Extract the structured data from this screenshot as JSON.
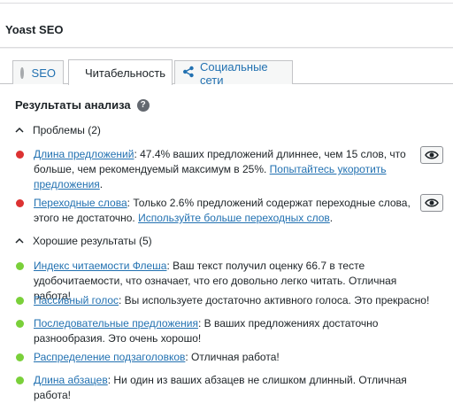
{
  "header": {
    "title": "Yoast SEO"
  },
  "tabs": [
    {
      "label": "SEO",
      "status_color": "#a7aaad"
    },
    {
      "label": "Читабельность",
      "status_color": "#ee7c1b"
    },
    {
      "label": "Социальные сети"
    }
  ],
  "panel": {
    "title": "Результаты анализа",
    "help_icon": "?",
    "problems": {
      "heading": "Проблемы (2)",
      "items": [
        {
          "link": "Длина предложений",
          "text": ": 47.4% ваших предложений длиннее, чем 15 слов, что больше, чем рекомендуемый максимум в 25%. ",
          "link2": "Попытайтесь укоротить предложения",
          "end": "."
        },
        {
          "link": "Переходные слова",
          "text": ": Только 2.6% предложений содержат переходные слова, этого не достаточно. ",
          "link2": "Используйте больше переходных слов",
          "end": "."
        }
      ]
    },
    "good": {
      "heading": "Хорошие результаты (5)",
      "items": [
        {
          "link": "Индекс читаемости Флеша",
          "text": ": Ваш текст получил оценку 66.7 в тесте удобочитаемости, что означает, что его довольно легко читать. Отличная работа!"
        },
        {
          "link": "Пассивный голос",
          "text": ": Вы используете достаточно активного голоса. Это прекрасно!"
        },
        {
          "link": "Последовательные предложения",
          "text": ": В ваших предложениях достаточно разнообразия. Это очень хорошо!"
        },
        {
          "link": "Распределение подзаголовков",
          "text": ": Отличная работа!"
        },
        {
          "link": "Длина абзацев",
          "text": ": Ни один из ваших абзацев не слишком длинный. Отличная работа!"
        }
      ]
    }
  }
}
